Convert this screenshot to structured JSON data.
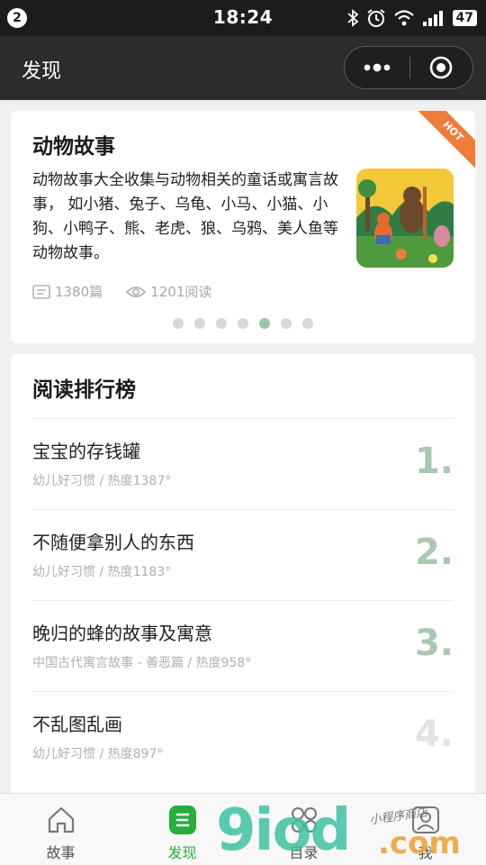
{
  "status": {
    "badge": "2",
    "time": "18:24",
    "battery": "47"
  },
  "header": {
    "title": "发现"
  },
  "feature": {
    "title": "动物故事",
    "description": "动物故事大全收集与动物相关的童话或寓言故事， 如小猪、兔子、乌龟、小马、小猫、小狗、小鸭子、熊、老虎、狼、乌鸦、美人鱼等动物故事。",
    "hot": "HOT",
    "articles": "1380篇",
    "reads": "1201阅读",
    "carousel_total": 7,
    "carousel_active": 5
  },
  "ranking": {
    "title": "阅读排行榜",
    "items": [
      {
        "title": "宝宝的存钱罐",
        "meta": "幼儿好习惯 / 热度1387°",
        "rank": "1."
      },
      {
        "title": "不随便拿别人的东西",
        "meta": "幼儿好习惯 / 热度1183°",
        "rank": "2."
      },
      {
        "title": "晚归的蜂的故事及寓意",
        "meta": "中国古代寓言故事 - 善恶篇 / 热度958°",
        "rank": "3."
      },
      {
        "title": "不乱图乱画",
        "meta": "幼儿好习惯 / 热度897°",
        "rank": "4."
      }
    ]
  },
  "tabs": [
    {
      "label": "故事",
      "icon": "house-icon",
      "active": false
    },
    {
      "label": "发现",
      "icon": "discover-icon",
      "active": true
    },
    {
      "label": "目录",
      "icon": "grid-icon",
      "active": false
    },
    {
      "label": "我",
      "icon": "profile-icon",
      "active": false
    }
  ],
  "watermark": {
    "main": "9iod",
    "suffix": ".com",
    "note": "小程序商店"
  },
  "colors": {
    "accent": "#27ae3c",
    "rank_number": "#a9c8b2",
    "hot": "#f07c3c",
    "header_bg": "#2b2b2b"
  }
}
